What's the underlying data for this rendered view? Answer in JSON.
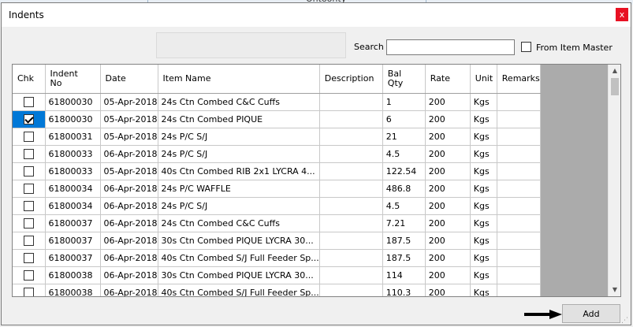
{
  "dialog": {
    "title": "Indents",
    "close_label": "x"
  },
  "search": {
    "label": "Search",
    "value": ""
  },
  "from_item_master": {
    "label": "From Item Master",
    "checked": false
  },
  "grid": {
    "headers": [
      "Chk",
      "Indent\nNo",
      "Date",
      "Item Name",
      "Description",
      "Bal\nQty",
      "Rate",
      "Unit",
      "Remarks"
    ],
    "rows": [
      {
        "chk": false,
        "indent_no": "61800030",
        "date": "05-Apr-2018",
        "item_name": "24s Ctn Combed C&C Cuffs",
        "description": "",
        "bal_qty": "1",
        "rate": "200",
        "unit": "Kgs",
        "remarks": ""
      },
      {
        "chk": true,
        "indent_no": "61800030",
        "date": "05-Apr-2018",
        "item_name": "24s Ctn Combed PIQUE",
        "description": "",
        "bal_qty": "6",
        "rate": "200",
        "unit": "Kgs",
        "remarks": ""
      },
      {
        "chk": false,
        "indent_no": "61800031",
        "date": "05-Apr-2018",
        "item_name": "24s P/C S/J",
        "description": "",
        "bal_qty": "21",
        "rate": "200",
        "unit": "Kgs",
        "remarks": ""
      },
      {
        "chk": false,
        "indent_no": "61800033",
        "date": "06-Apr-2018",
        "item_name": "24s P/C S/J",
        "description": "",
        "bal_qty": "4.5",
        "rate": "200",
        "unit": "Kgs",
        "remarks": ""
      },
      {
        "chk": false,
        "indent_no": "61800033",
        "date": "05-Apr-2018",
        "item_name": "40s Ctn Combed  RIB 2x1 LYCRA 4...",
        "description": "",
        "bal_qty": "122.54",
        "rate": "200",
        "unit": "Kgs",
        "remarks": ""
      },
      {
        "chk": false,
        "indent_no": "61800034",
        "date": "06-Apr-2018",
        "item_name": "24s P/C WAFFLE",
        "description": "",
        "bal_qty": "486.8",
        "rate": "200",
        "unit": "Kgs",
        "remarks": ""
      },
      {
        "chk": false,
        "indent_no": "61800034",
        "date": "06-Apr-2018",
        "item_name": "24s P/C S/J",
        "description": "",
        "bal_qty": "4.5",
        "rate": "200",
        "unit": "Kgs",
        "remarks": ""
      },
      {
        "chk": false,
        "indent_no": "61800037",
        "date": "06-Apr-2018",
        "item_name": "24s Ctn Combed C&C Cuffs",
        "description": "",
        "bal_qty": "7.21",
        "rate": "200",
        "unit": "Kgs",
        "remarks": ""
      },
      {
        "chk": false,
        "indent_no": "61800037",
        "date": "06-Apr-2018",
        "item_name": "30s Ctn Combed PIQUE  LYCRA 30...",
        "description": "",
        "bal_qty": "187.5",
        "rate": "200",
        "unit": "Kgs",
        "remarks": ""
      },
      {
        "chk": false,
        "indent_no": "61800037",
        "date": "06-Apr-2018",
        "item_name": "40s Ctn Combed S/J Full Feeder Sp...",
        "description": "",
        "bal_qty": "187.5",
        "rate": "200",
        "unit": "Kgs",
        "remarks": ""
      },
      {
        "chk": false,
        "indent_no": "61800038",
        "date": "06-Apr-2018",
        "item_name": "30s Ctn Combed PIQUE  LYCRA 30...",
        "description": "",
        "bal_qty": "114",
        "rate": "200",
        "unit": "Kgs",
        "remarks": ""
      },
      {
        "chk": false,
        "indent_no": "61800038",
        "date": "06-Apr-2018",
        "item_name": "40s Ctn Combed S/J Full Feeder Sp...",
        "description": "",
        "bal_qty": "110.3",
        "rate": "200",
        "unit": "Kgs",
        "remarks": ""
      }
    ]
  },
  "add_button": {
    "label": "Add"
  },
  "colors": {
    "selection": "#0078d7",
    "close": "#e81123",
    "grid_empty": "#ababab"
  },
  "icons": [
    "close-icon",
    "scroll-up-icon",
    "scroll-down-icon",
    "arrow-right-icon",
    "resize-grip-icon"
  ]
}
